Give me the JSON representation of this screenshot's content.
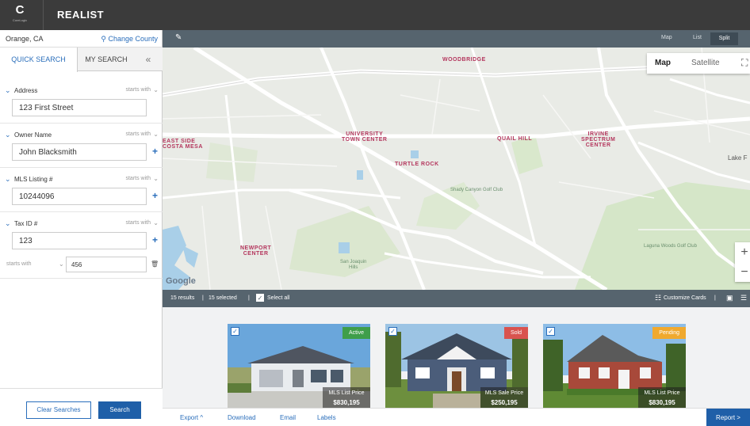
{
  "app": {
    "logo_mark": "C",
    "logo_sub": "CoreLogic",
    "title": "REALIST"
  },
  "location": {
    "county": "Orange, CA",
    "change_label": "Change County",
    "pin_icon": "map-pin-icon"
  },
  "tabs": {
    "quick": "QUICK SEARCH",
    "mine": "MY SEARCH",
    "collapse": "«"
  },
  "fields": [
    {
      "label": "Address",
      "mode": "starts with",
      "value": "123 First Street",
      "has_plus": false
    },
    {
      "label": "Owner Name",
      "mode": "starts with",
      "value": "John Blacksmith",
      "has_plus": true
    },
    {
      "label": "MLS Listing #",
      "mode": "starts with",
      "value": "10244096",
      "has_plus": true
    },
    {
      "label": "Tax ID #",
      "mode": "starts with",
      "value": "123",
      "has_plus": true,
      "sub_mode": "starts with",
      "sub_value": "456"
    }
  ],
  "buttons": {
    "clear": "Clear Searches",
    "search": "Search"
  },
  "view_tabs": {
    "map": "Map",
    "list": "List",
    "split": "Split"
  },
  "map": {
    "type_map": "Map",
    "type_satellite": "Satellite",
    "zoom_in": "+",
    "zoom_out": "−",
    "google": "Google",
    "labels": {
      "woodbridge": "WOODBRIDGE",
      "univ_town": "UNIVERSITY\nTOWN CENTER",
      "quail_hill": "QUAIL HILL",
      "irvine_spectrum": "IRVINE\nSPECTRUM\nCENTER",
      "east_side": "EAST SIDE\nCOSTA MESA",
      "turtle_rock": "TURTLE ROCK",
      "newport": "NEWPORT\nCENTER",
      "lake_forest": "Lake F",
      "shady_canyon": "Shady Canyon Golf Club",
      "san_joaquin": "San Joaquin\nHills",
      "laguna_woods": "Laguna Woods Golf Club"
    }
  },
  "results": {
    "count": "15 results",
    "selected": "15 selected",
    "select_all": "Select all",
    "customize": "Customize Cards"
  },
  "cards": [
    {
      "status": "Active",
      "status_color": "#3f9e4a",
      "price_label": "MLS List Price",
      "price": "$830,195"
    },
    {
      "status": "Sold",
      "status_color": "#d9534f",
      "price_label": "MLS Sale Price",
      "price": "$250,195"
    },
    {
      "status": "Pending",
      "status_color": "#f0a92e",
      "price_label": "MLS List Price",
      "price": "$830,195"
    }
  ],
  "bottom": {
    "export": "Export ^",
    "download": "Download",
    "email": "Email",
    "labels": "Labels",
    "report": "Report >"
  },
  "colors": {
    "topbar": "#3b3b3b",
    "toolbar": "#56646e",
    "accent": "#2a6ebb",
    "primary_button": "#1f5fa8"
  }
}
